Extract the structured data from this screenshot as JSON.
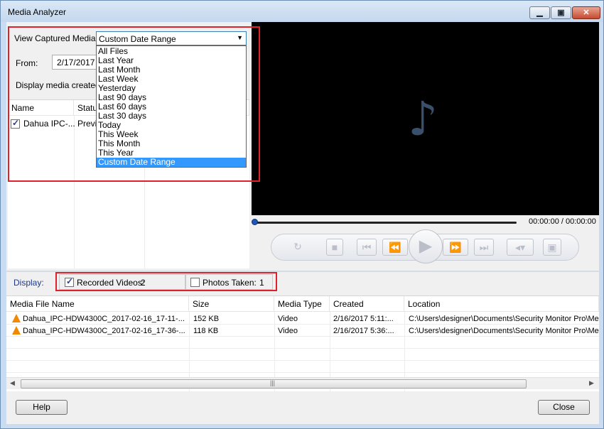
{
  "window": {
    "title": "Media Analyzer"
  },
  "left": {
    "view_label": "View Captured Media:",
    "view_value": "Custom Date Range",
    "from_label": "From:",
    "from_value": "2/17/2017",
    "display_hint": "Display media created fr",
    "columns": [
      "Name",
      "Status"
    ],
    "rows": [
      {
        "name": "Dahua IPC-...",
        "status": "Previ",
        "checked": true
      }
    ]
  },
  "dropdown": {
    "options": [
      "All Files",
      "Last Year",
      "Last Month",
      "Last Week",
      "Yesterday",
      "Last 90 days",
      "Last 60 days",
      "Last 30 days",
      "Today",
      "This Week",
      "This Month",
      "This Year",
      "Custom Date Range"
    ],
    "selected": "Custom Date Range"
  },
  "player": {
    "time": "00:00:00 / 00:00:00",
    "icon": "music-note-icon",
    "progress": 0
  },
  "display": {
    "label": "Display:",
    "recorded_label": "Recorded Videos:",
    "recorded_count": "2",
    "recorded_checked": true,
    "photos_label": "Photos Taken:",
    "photos_count": "1",
    "photos_checked": false
  },
  "table": {
    "columns": [
      "Media File Name",
      "Size",
      "Media Type",
      "Created",
      "Location"
    ],
    "rows": [
      {
        "name": "Dahua_IPC-HDW4300C_2017-02-16_17-11-...",
        "size": "152 KB",
        "type": "Video",
        "created": "2/16/2017 5:11:...",
        "location": "C:\\Users\\designer\\Documents\\Security Monitor Pro\\Mec"
      },
      {
        "name": "Dahua_IPC-HDW4300C_2017-02-16_17-36-...",
        "size": "118 KB",
        "type": "Video",
        "created": "2/16/2017 5:36:...",
        "location": "C:\\Users\\designer\\Documents\\Security Monitor Pro\\Mec"
      }
    ]
  },
  "buttons": {
    "help": "Help",
    "close": "Close"
  },
  "colors": {
    "highlight": "#e0202a",
    "selection": "#3399ff",
    "video_bg": "#000000",
    "vlc_icon": "#f08a00"
  }
}
